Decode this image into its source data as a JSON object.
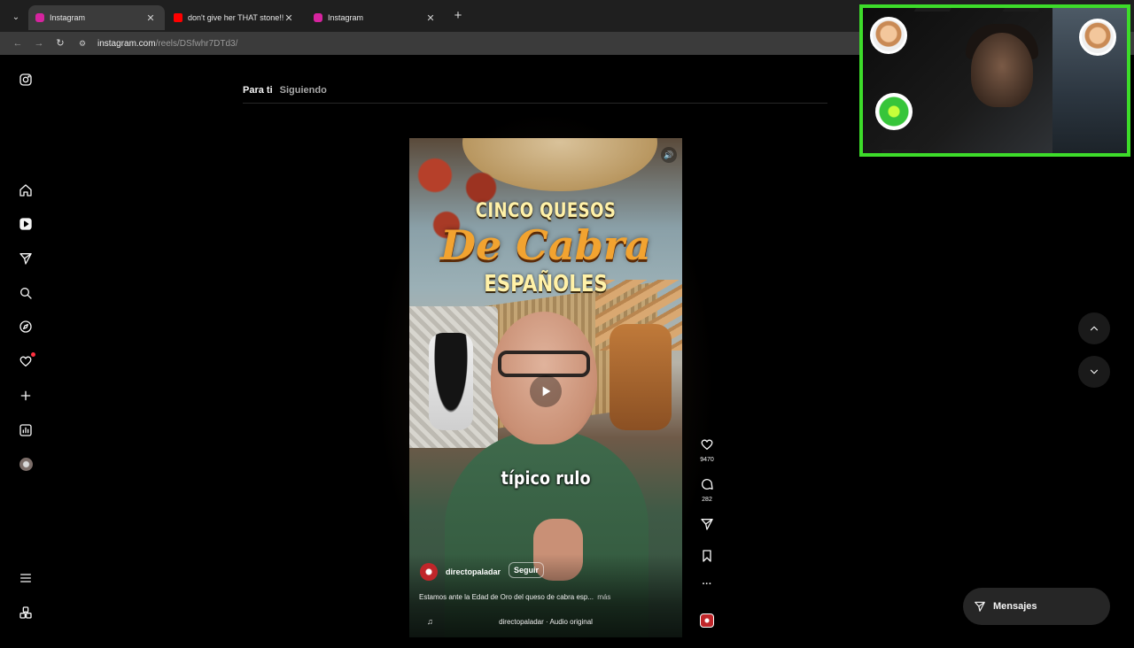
{
  "browser": {
    "tabs": [
      {
        "title": "Instagram",
        "favicon": "instagram-icon",
        "color": "#d6249f",
        "active": true
      },
      {
        "title": "don't give her THAT stone!!! - Y",
        "favicon": "youtube-icon",
        "color": "#ff0000",
        "active": false
      },
      {
        "title": "Instagram",
        "favicon": "instagram-icon",
        "color": "#d6249f",
        "active": false
      }
    ],
    "close_glyph": "✕",
    "url_host": "instagram.com",
    "url_path": "/reels/DSfwhr7DTd3/"
  },
  "feed": {
    "tab_active": "Para ti",
    "tab_inactive": "Siguiendo"
  },
  "reel": {
    "overlay_title_1": "CINCO QUESOS",
    "overlay_title_2": "De Cabra",
    "overlay_title_3": "ESPAÑOLES",
    "subtitle": "típico rulo",
    "author": "directopaladar",
    "follow_label": "Seguir",
    "description": "Estamos ante la Edad de Oro del queso de cabra esp...",
    "more_label": "más",
    "audio": "directopaladar · Audio original"
  },
  "actions": {
    "likes": "9470",
    "comments": "282",
    "more_glyph": "···"
  },
  "messages": {
    "label": "Mensajes"
  },
  "colors": {
    "overlay_border": "#3ddc2a",
    "notification": "#ff3040",
    "background": "#000000"
  }
}
